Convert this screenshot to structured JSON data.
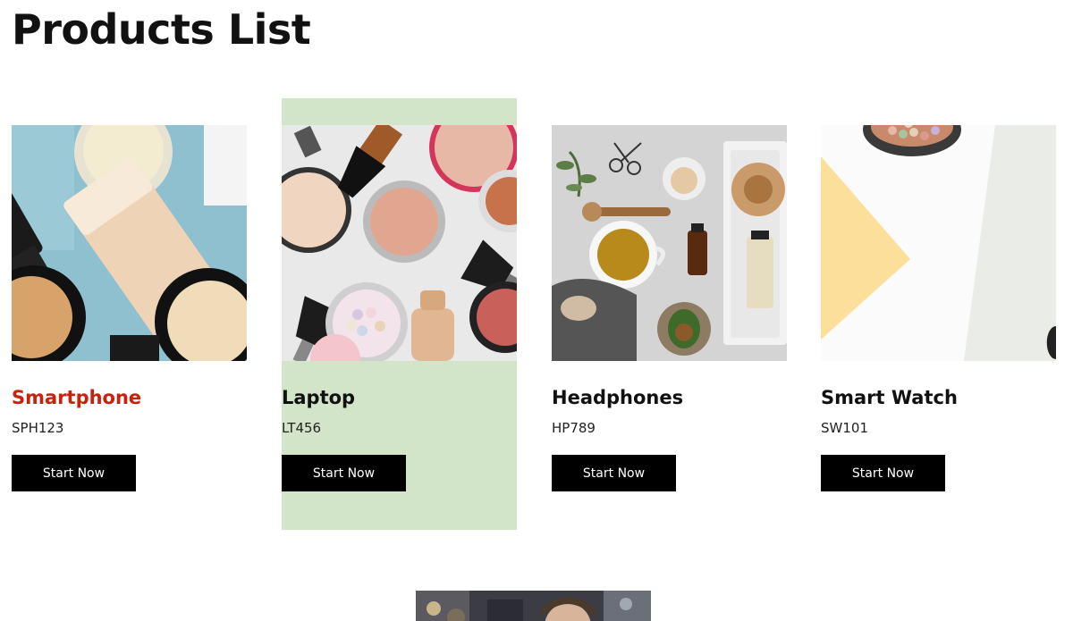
{
  "page": {
    "title": "Products List"
  },
  "colors": {
    "highlight_background": "#d2e5c8",
    "active_title": "#c8210c",
    "button_background": "#000000",
    "button_text": "#ffffff"
  },
  "products": [
    {
      "name": "Smartphone",
      "code": "SPH123",
      "button_label": "Start Now",
      "image": "cosmetics-foundation-bottles-image",
      "state": "title-hovered"
    },
    {
      "name": "Laptop",
      "code": "LT456",
      "button_label": "Start Now",
      "image": "makeup-brushes-powders-image",
      "state": "card-highlighted"
    },
    {
      "name": "Headphones",
      "code": "HP789",
      "button_label": "Start Now",
      "image": "spa-tea-avocado-flatlay-image",
      "state": "normal"
    },
    {
      "name": "Smart Watch",
      "code": "SW101",
      "button_label": "Start Now",
      "image": "pearl-powder-pastel-paper-image",
      "state": "normal"
    }
  ],
  "bottom_image": "event-crowd-image"
}
